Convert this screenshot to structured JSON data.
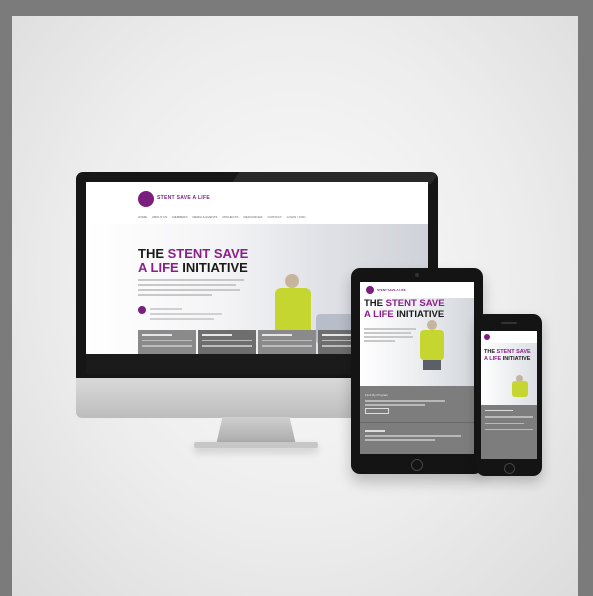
{
  "scene": {
    "description_label": "responsive-website-mockup"
  },
  "site": {
    "brand": "STENT SAVE A LIFE",
    "nav_items": [
      "HOME",
      "ABOUT US",
      "MEMBERS",
      "MEDIA & EVENTS",
      "PROJECTS",
      "RESOURCES",
      "CONTACT",
      "LOGIN / JOIN"
    ],
    "hero_title_prefix": "THE ",
    "hero_title_highlight": "STENT SAVE",
    "hero_title_line2_highlight": "A LIFE",
    "hero_title_suffix": " INITIATIVE",
    "tiles": [
      "Find My Program",
      "Join SSL",
      "Stent Save a Life",
      "Media Centre"
    ]
  },
  "tablet": {
    "title_prefix": "THE ",
    "title_highlight": "STENT SAVE",
    "title_line2_highlight": "A LIFE",
    "title_suffix": " INITIATIVE"
  },
  "phone": {
    "title_prefix": "THE ",
    "title_highlight": "STENT SAVE",
    "title_line2_highlight": "A LIFE",
    "title_suffix": " INITIATIVE"
  },
  "colors": {
    "brand_purple": "#8a1f8c",
    "vest_yellow": "#c6d630",
    "background": "#7b7b7b"
  }
}
